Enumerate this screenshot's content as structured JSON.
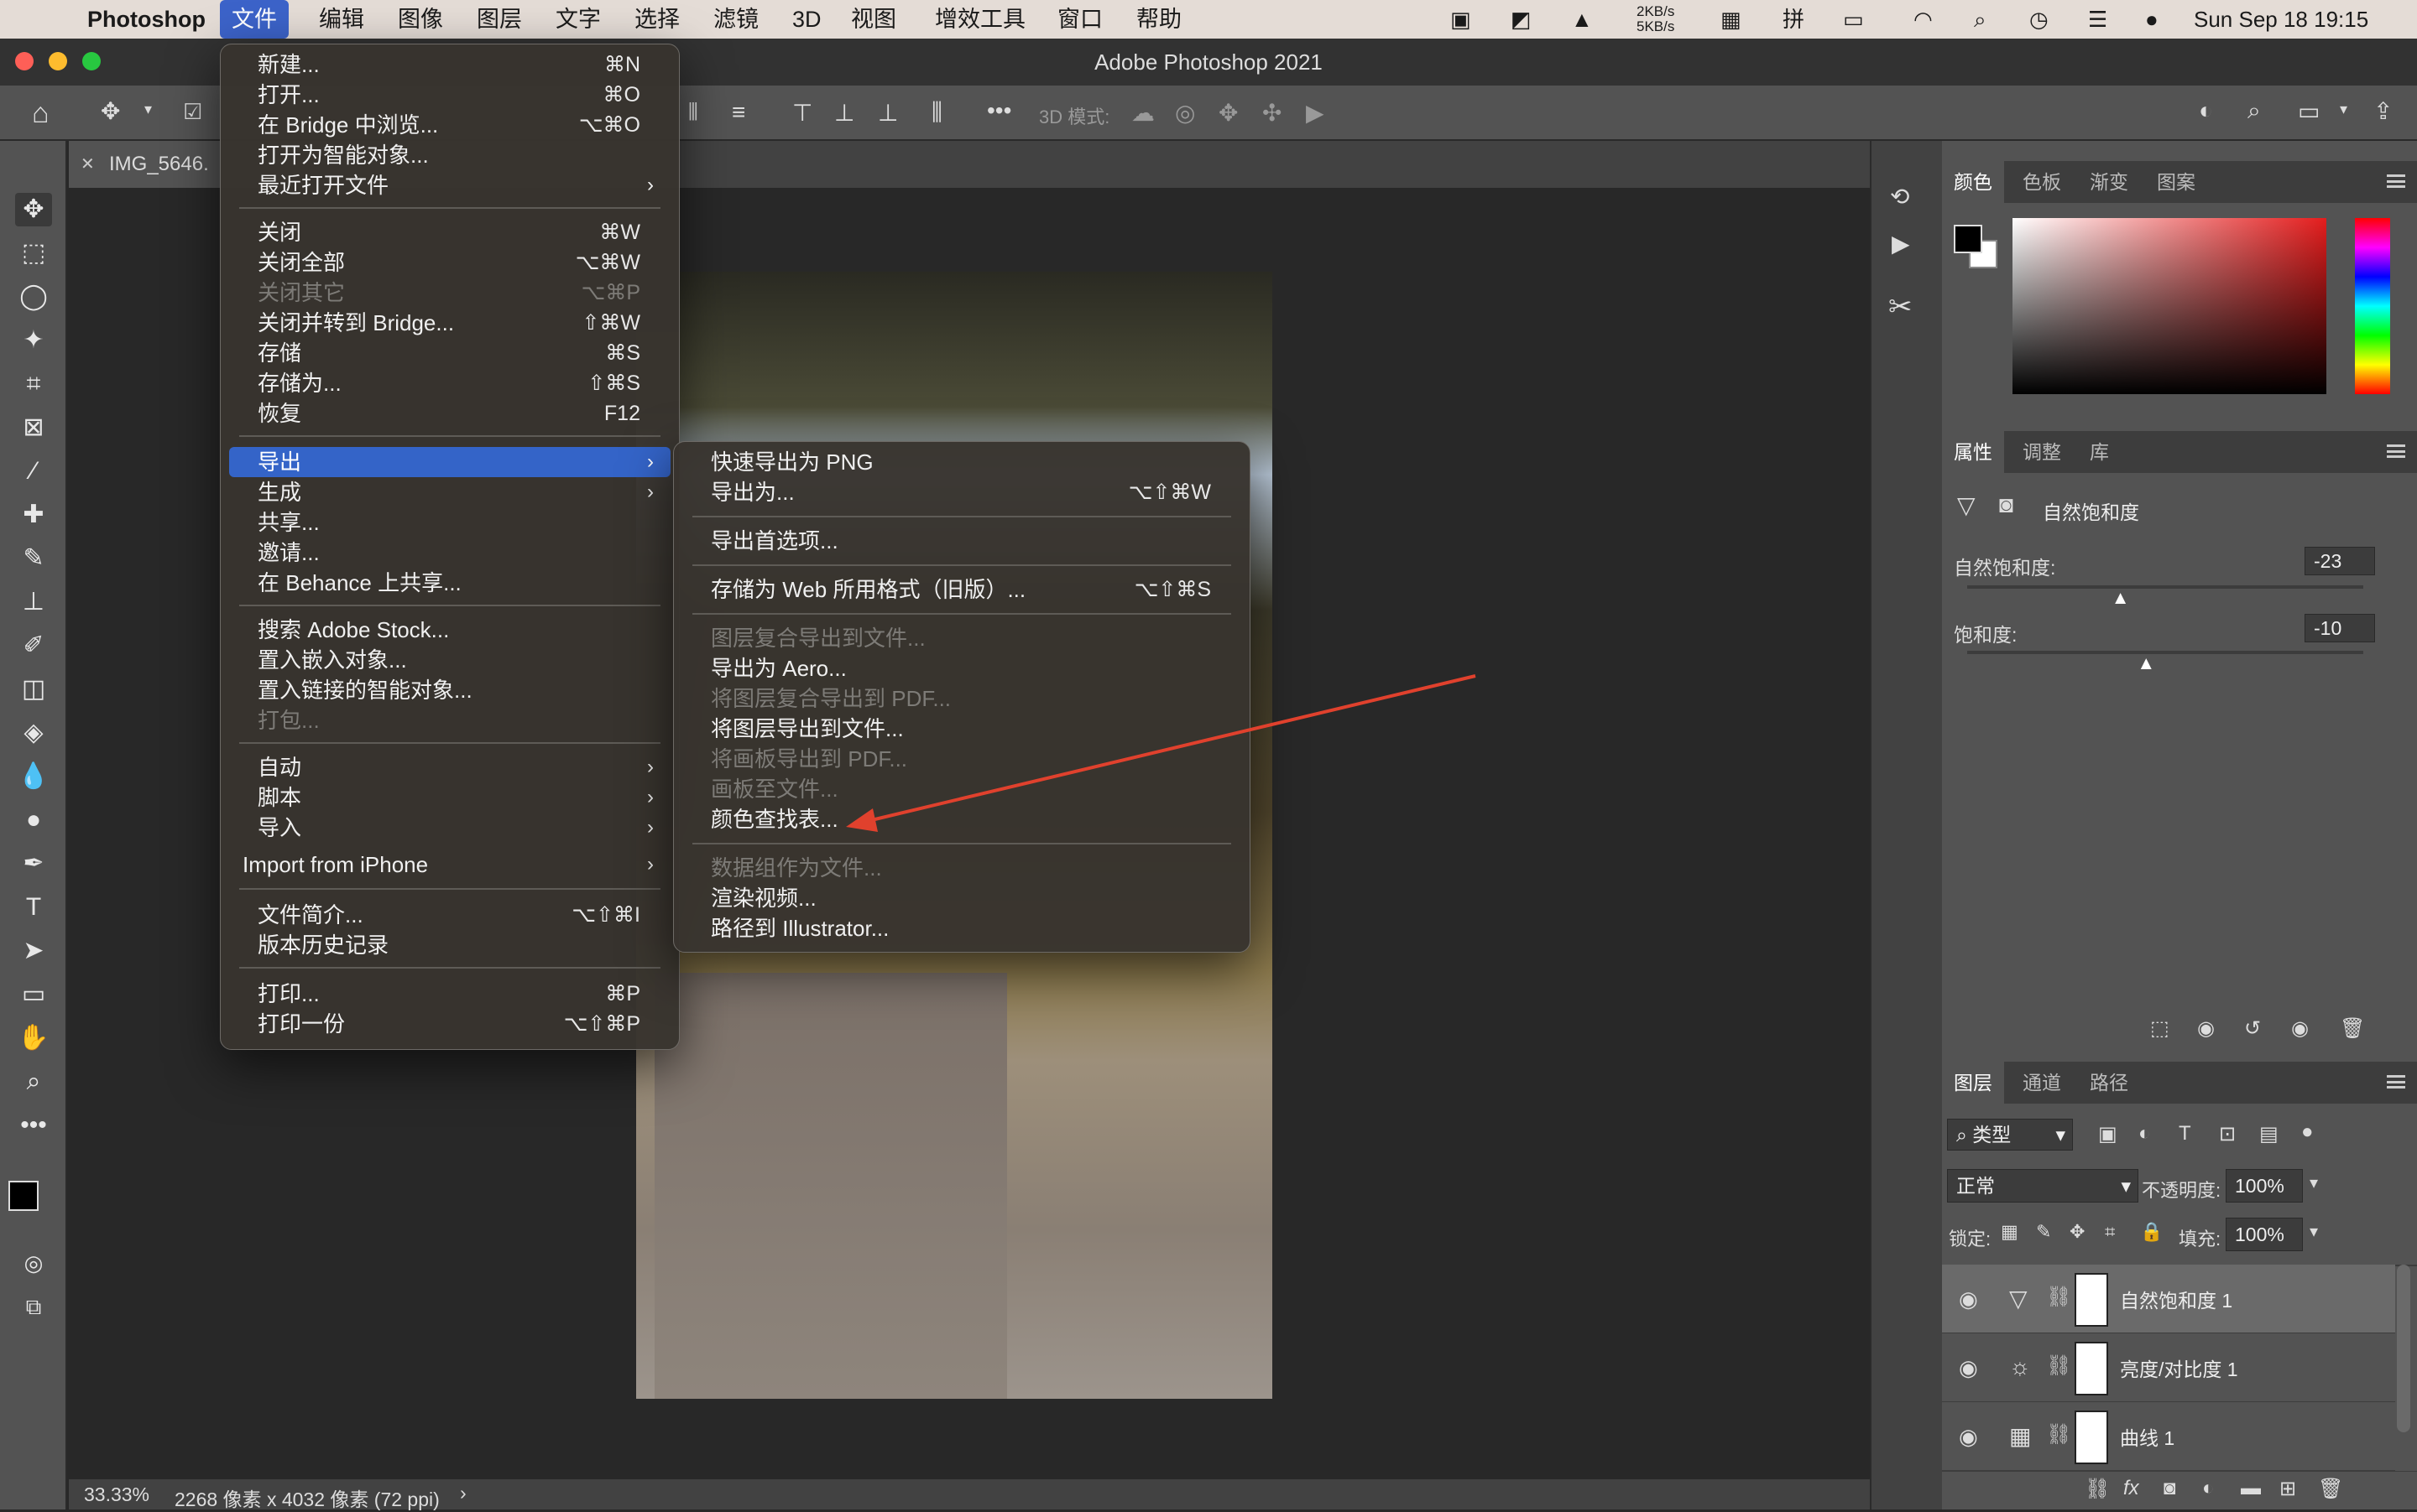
{
  "menubar": {
    "apple": "",
    "app": "Photoshop",
    "items": [
      "文件",
      "编辑",
      "图像",
      "图层",
      "文字",
      "选择",
      "滤镜",
      "3D",
      "视图",
      "增效工具",
      "窗口",
      "帮助"
    ],
    "net_up": "2KB/s",
    "net_down": "5KB/s",
    "clock": "Sun Sep 18  19:15"
  },
  "window": {
    "title": "Adobe Photoshop 2021"
  },
  "options": {
    "mode_label": "3D 模式:"
  },
  "document": {
    "tab": "IMG_5646.",
    "zoom": "33.33%",
    "info": "2268 像素 x 4032 像素 (72 ppi)"
  },
  "file_menu": {
    "items": [
      {
        "label": "新建...",
        "shortcut": "⌘N"
      },
      {
        "label": "打开...",
        "shortcut": "⌘O"
      },
      {
        "label": "在 Bridge 中浏览...",
        "shortcut": "⌥⌘O"
      },
      {
        "label": "打开为智能对象...",
        "shortcut": ""
      },
      {
        "label": "最近打开文件",
        "shortcut": "",
        "sub": true
      },
      {
        "label": "关闭",
        "shortcut": "⌘W"
      },
      {
        "label": "关闭全部",
        "shortcut": "⌥⌘W"
      },
      {
        "label": "关闭其它",
        "shortcut": "⌥⌘P",
        "disabled": true
      },
      {
        "label": "关闭并转到 Bridge...",
        "shortcut": "⇧⌘W"
      },
      {
        "label": "存储",
        "shortcut": "⌘S"
      },
      {
        "label": "存储为...",
        "shortcut": "⇧⌘S"
      },
      {
        "label": "恢复",
        "shortcut": "F12"
      },
      {
        "label": "导出",
        "shortcut": "",
        "sub": true,
        "selected": true
      },
      {
        "label": "生成",
        "shortcut": "",
        "sub": true
      },
      {
        "label": "共享...",
        "shortcut": ""
      },
      {
        "label": "邀请...",
        "shortcut": ""
      },
      {
        "label": "在 Behance 上共享...",
        "shortcut": ""
      },
      {
        "label": "搜索 Adobe Stock...",
        "shortcut": ""
      },
      {
        "label": "置入嵌入对象...",
        "shortcut": ""
      },
      {
        "label": "置入链接的智能对象...",
        "shortcut": ""
      },
      {
        "label": "打包...",
        "shortcut": "",
        "disabled": true
      },
      {
        "label": "自动",
        "shortcut": "",
        "sub": true
      },
      {
        "label": "脚本",
        "shortcut": "",
        "sub": true
      },
      {
        "label": "导入",
        "shortcut": "",
        "sub": true
      },
      {
        "label": "Import from iPhone",
        "shortcut": "",
        "sub": true
      },
      {
        "label": "文件简介...",
        "shortcut": "⌥⇧⌘I"
      },
      {
        "label": "版本历史记录",
        "shortcut": ""
      },
      {
        "label": "打印...",
        "shortcut": "⌘P"
      },
      {
        "label": "打印一份",
        "shortcut": "⌥⇧⌘P"
      }
    ]
  },
  "export_menu": {
    "items": [
      {
        "label": "快速导出为 PNG",
        "shortcut": ""
      },
      {
        "label": "导出为...",
        "shortcut": "⌥⇧⌘W"
      },
      {
        "label": "导出首选项...",
        "shortcut": ""
      },
      {
        "label": "存储为 Web 所用格式（旧版）...",
        "shortcut": "⌥⇧⌘S"
      },
      {
        "label": "图层复合导出到文件...",
        "shortcut": "",
        "disabled": true
      },
      {
        "label": "导出为 Aero...",
        "shortcut": ""
      },
      {
        "label": "将图层复合导出到 PDF...",
        "shortcut": "",
        "disabled": true
      },
      {
        "label": "将图层导出到文件...",
        "shortcut": ""
      },
      {
        "label": "将画板导出到 PDF...",
        "shortcut": "",
        "disabled": true
      },
      {
        "label": "画板至文件...",
        "shortcut": "",
        "disabled": true
      },
      {
        "label": "颜色查找表...",
        "shortcut": ""
      },
      {
        "label": "数据组作为文件...",
        "shortcut": "",
        "disabled": true
      },
      {
        "label": "渲染视频...",
        "shortcut": ""
      },
      {
        "label": "路径到 Illustrator...",
        "shortcut": ""
      }
    ]
  },
  "color_panel": {
    "tabs": [
      "颜色",
      "色板",
      "渐变",
      "图案"
    ]
  },
  "properties_panel": {
    "tabs": [
      "属性",
      "调整",
      "库"
    ],
    "title": "自然饱和度",
    "vibrance_label": "自然饱和度:",
    "vibrance_value": "-23",
    "vibrance_level": -23,
    "saturation_label": "饱和度:",
    "saturation_value": "-10",
    "saturation_level": -10
  },
  "layers_panel": {
    "tabs": [
      "图层",
      "通道",
      "路径"
    ],
    "filter": "类型",
    "blend_mode": "正常",
    "opacity_label": "不透明度:",
    "opacity": "100%",
    "lock_label": "锁定:",
    "fill_label": "填充:",
    "fill": "100%",
    "layers": [
      {
        "name": "自然饱和度 1",
        "icon": "vibrance-icon",
        "selected": true
      },
      {
        "name": "亮度/对比度 1",
        "icon": "brightness-icon"
      },
      {
        "name": "曲线 1",
        "icon": "curves-icon"
      }
    ]
  },
  "colors": {
    "accent": "#3464c8",
    "arrow": "#e0412d"
  }
}
